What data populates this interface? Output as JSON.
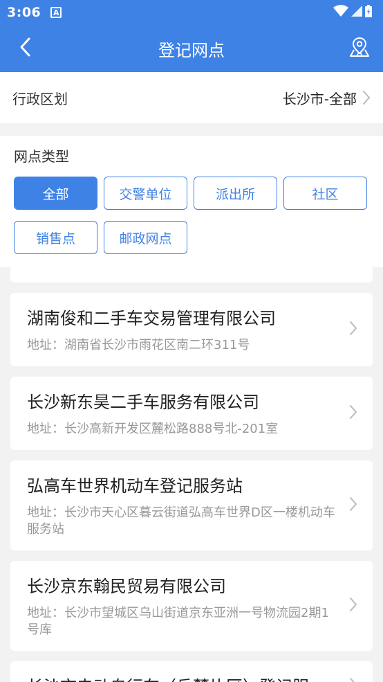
{
  "status": {
    "time": "3:06",
    "a_badge": "A"
  },
  "header": {
    "title": "登记网点"
  },
  "district": {
    "label": "行政区划",
    "value": "长沙市-全部"
  },
  "filter": {
    "label": "网点类型",
    "chips": [
      "全部",
      "交警单位",
      "派出所",
      "社区",
      "销售点",
      "邮政网点"
    ],
    "selected": "全部"
  },
  "list": [
    {
      "name": "湖南俊和二手车交易管理有限公司",
      "address": "地址：湖南省长沙市雨花区南二环311号"
    },
    {
      "name": "长沙新东昊二手车服务有限公司",
      "address": "地址：长沙高新开发区麓松路888号北-201室"
    },
    {
      "name": "弘高车世界机动车登记服务站",
      "address": "地址：长沙市天心区暮云街道弘高车世界D区一楼机动车服务站"
    },
    {
      "name": "长沙京东翰民贸易有限公司",
      "address": "地址：长沙市望城区乌山街道京东亚洲一号物流园2期1号库"
    },
    {
      "name": "长沙市电动自行车（岳麓片区）登记服务站",
      "address": ""
    }
  ],
  "colors": {
    "accent": "#3f82e6",
    "background": "#f2f2f2"
  },
  "icons": {
    "back": "chevron-left-icon",
    "map": "map-pin-icon",
    "row_chevron": "chevron-right-icon",
    "wifi": "wifi-icon",
    "signal": "signal-icon",
    "battery": "battery-icon"
  }
}
